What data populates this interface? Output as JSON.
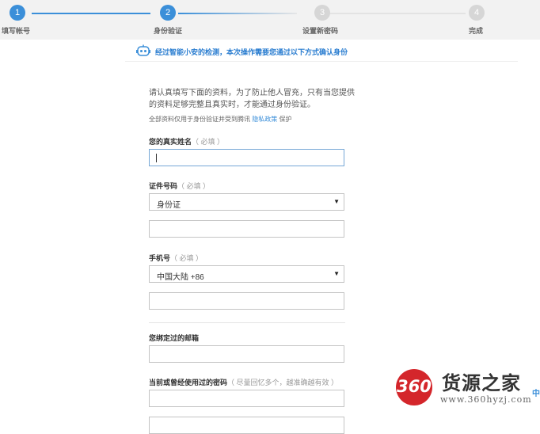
{
  "steps": [
    {
      "num": "1",
      "label": "填写帐号"
    },
    {
      "num": "2",
      "label": "身份验证"
    },
    {
      "num": "3",
      "label": "设置新密码"
    },
    {
      "num": "4",
      "label": "完成"
    }
  ],
  "notice": {
    "text": "经过智能小安的检测，本次操作需要您通过以下方式确认身份",
    "icon": "robot-icon"
  },
  "intro": {
    "text": "请认真填写下面的资料，为了防止他人冒充，只有当您提供的资料足够完整且真实时，才能通过身份验证。",
    "privacy_prefix": "全部资料仅用于身份验证并受到腾讯",
    "privacy_link": "隐私政策",
    "privacy_suffix": "保护"
  },
  "form": {
    "name": {
      "label": "您的真实姓名",
      "required": "（ 必填 ）",
      "value": ""
    },
    "id": {
      "label": "证件号码",
      "required": "（ 必填 ）",
      "type_selected": "身份证",
      "number_value": ""
    },
    "phone": {
      "label": "手机号",
      "required": "（ 必填 ）",
      "region_selected": "中国大陆 +86",
      "number_value": ""
    },
    "email": {
      "label": "您绑定过的邮箱",
      "value": ""
    },
    "password": {
      "label": "当前或曾经使用过的密码",
      "hint": "（ 尽量回忆多个，越准确越有效 ）",
      "value": ""
    }
  },
  "watermark": {
    "badge": "360",
    "name": "货源之家",
    "url": "www.360hyzj.com"
  },
  "edge_tab": {
    "text": "中"
  },
  "colors": {
    "accent": "#3b8fd9",
    "badge_red": "#d4262b"
  }
}
